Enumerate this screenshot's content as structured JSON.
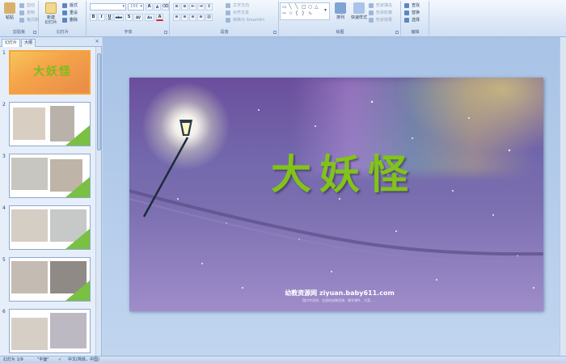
{
  "ribbon": {
    "clipboard": {
      "paste": "粘贴",
      "cut": "剪切",
      "copy": "复制",
      "format_painter": "格式刷",
      "label": "剪贴板"
    },
    "slides": {
      "new_slide_line1": "新建",
      "new_slide_line2": "幻灯片",
      "layout": "版式",
      "reset": "重设",
      "delete": "删除",
      "label": "幻灯片"
    },
    "font": {
      "name": "",
      "size": "166",
      "label": "字体",
      "bold": "B",
      "italic": "I",
      "underline": "U",
      "strike": "abe",
      "shadow": "S",
      "spacing": "AV",
      "case": "Aa",
      "color": "A",
      "grow": "A",
      "shrink": "A"
    },
    "paragraph": {
      "text_direction": "文字方向",
      "align_text": "对齐文本",
      "convert_smartart": "转换为 SmartArt",
      "label": "段落"
    },
    "drawing": {
      "arrange": "排列",
      "quick_styles": "快速样式",
      "fill": "形状填充",
      "outline": "形状轮廓",
      "effects": "形状效果",
      "label": "绘图"
    },
    "editing": {
      "find": "查找",
      "replace": "替换",
      "select": "选择",
      "label": "编辑"
    }
  },
  "pane": {
    "tab_slides": "幻灯片",
    "tab_outline": "大纲",
    "close": "×"
  },
  "thumbnails": [
    {
      "num": "1",
      "title": "大妖怪"
    },
    {
      "num": "2"
    },
    {
      "num": "3"
    },
    {
      "num": "4"
    },
    {
      "num": "5"
    },
    {
      "num": "6"
    }
  ],
  "slide": {
    "title": "大妖怪",
    "footer_url": "幼教资源网 ziyuan.baby611.com",
    "footer_sub": "国内专业的、全面的幼教资源，教学课件、方案……"
  },
  "status": {
    "slide_count": "幻灯片 1/9",
    "theme": "\"平面\"",
    "language": "中文(简体，中国)"
  },
  "colors": {
    "title_green": "#82c319",
    "thumb_selected": "#f7a43a",
    "ribbon_bg": "#dce8f7"
  }
}
